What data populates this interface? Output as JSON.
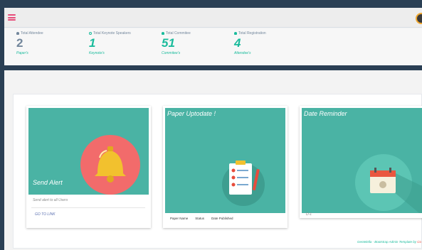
{
  "topbar": {
    "menu_icon": "hamburger-icon",
    "avatar_icon": "user-avatar"
  },
  "stats": [
    {
      "label": "Total Attendee",
      "value": "2",
      "sub": "Paper's",
      "icon": "user-icon",
      "color": "#73879c"
    },
    {
      "label": "Total Keynote Speakers",
      "value": "1",
      "sub": "Keynote's",
      "icon": "clock-icon",
      "color": "#1abb9c"
    },
    {
      "label": "Total Commitee",
      "value": "51",
      "sub": "Commitee's",
      "icon": "user-icon",
      "color": "#1abb9c"
    },
    {
      "label": "Total Registration",
      "value": "4",
      "sub": "Attendee's",
      "icon": "user-icon",
      "color": "#1abb9c"
    }
  ],
  "cards": {
    "alert": {
      "title": "Send Alert",
      "desc": "Send alert to all Users",
      "link": "GO TO LINK",
      "icon": "bell-icon"
    },
    "paper": {
      "title": "Paper Uptodate !",
      "columns": [
        "Paper Name",
        "Status",
        "Date Published"
      ],
      "icon": "clipboard-icon"
    },
    "reminder": {
      "title": "Date Reminder",
      "desc": "D-1",
      "icon": "calendar-icon"
    }
  },
  "footer": {
    "text": "Gentelella - Bootstrap Admin Template by ",
    "link": "Co"
  },
  "colors": {
    "teal": "#4ab3a4",
    "navy": "#2a3f54",
    "accent": "#1abb9c",
    "pink": "#e74c7a"
  }
}
